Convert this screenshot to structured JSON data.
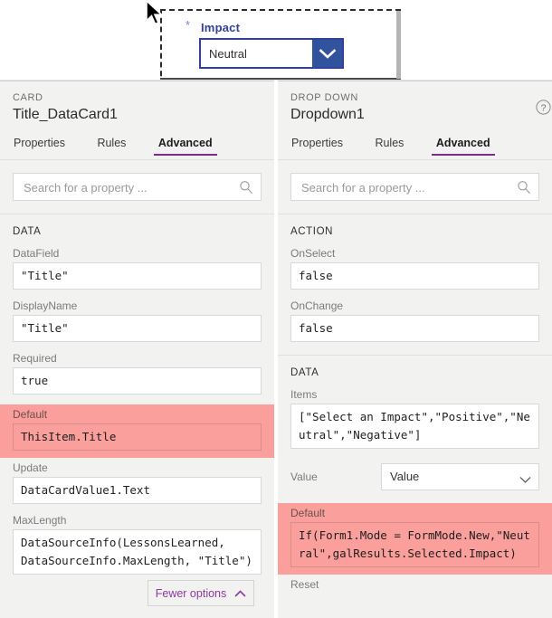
{
  "canvas": {
    "field": {
      "required_marker": "*",
      "label": "Impact",
      "dropdown_value": "Neutral",
      "chevron_icon": "chevron-down-icon"
    },
    "cursor_icon": "mouse-pointer-icon",
    "selection_color": "#2b2b2b",
    "accent_blue": "#31419b"
  },
  "left_pane": {
    "kind": "CARD",
    "title": "Title_DataCard1",
    "tabs": [
      {
        "label": "Properties",
        "active": false
      },
      {
        "label": "Rules",
        "active": false
      },
      {
        "label": "Advanced",
        "active": true
      }
    ],
    "search": {
      "placeholder": "Search for a property ...",
      "value": "",
      "icon": "search-icon"
    },
    "groups": [
      {
        "name": "DATA"
      }
    ],
    "properties": [
      {
        "label": "DataField",
        "value": "\"Title\"",
        "highlight": false
      },
      {
        "label": "DisplayName",
        "value": "\"Title\"",
        "highlight": false
      },
      {
        "label": "Required",
        "value": "true",
        "highlight": false
      },
      {
        "label": "Default",
        "value": "ThisItem.Title",
        "highlight": true
      },
      {
        "label": "Update",
        "value": "DataCardValue1.Text",
        "highlight": false
      },
      {
        "label": "MaxLength",
        "value": "DataSourceInfo(LessonsLearned, DataSourceInfo.MaxLength, \"Title\")",
        "highlight": false
      }
    ],
    "fewer_options": {
      "label": "Fewer options",
      "icon": "chevron-up-icon"
    }
  },
  "right_pane": {
    "kind": "DROP DOWN",
    "title": "Dropdown1",
    "help_icon": "help-circle-icon",
    "tabs": [
      {
        "label": "Properties",
        "active": false
      },
      {
        "label": "Rules",
        "active": false
      },
      {
        "label": "Advanced",
        "active": true
      }
    ],
    "search": {
      "placeholder": "Search for a property ...",
      "value": "",
      "icon": "search-icon"
    },
    "action_group": "ACTION",
    "action_properties": [
      {
        "label": "OnSelect",
        "value": "false"
      },
      {
        "label": "OnChange",
        "value": "false"
      }
    ],
    "data_group": "DATA",
    "items_property": {
      "label": "Items",
      "value": "[\"Select an Impact\",\"Positive\",\"Neutral\",\"Negative\"]"
    },
    "value_row": {
      "label": "Value",
      "selected": "Value",
      "chevron_icon": "chevron-down-icon"
    },
    "default_property": {
      "label": "Default",
      "value": "If(Form1.Mode = FormMode.New,\"Neutral\",galResults.Selected.Impact)",
      "highlight_color": "#fa9f9c"
    },
    "next_property_partial": {
      "label": "Reset"
    }
  }
}
